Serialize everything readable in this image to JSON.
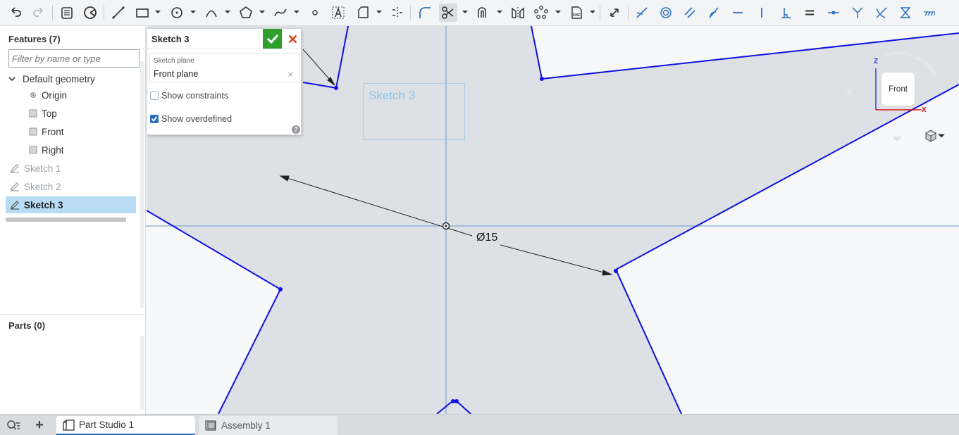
{
  "toolbar": {
    "tools": [
      {
        "name": "undo-icon"
      },
      {
        "name": "redo-icon"
      },
      {
        "name": "finish-sketch-icon"
      },
      {
        "name": "sketch-palette-icon"
      },
      {
        "name": "line-tool-icon"
      },
      {
        "name": "rectangle-tool-icon"
      },
      {
        "name": "circle-tool-icon"
      },
      {
        "name": "arc-tool-icon"
      },
      {
        "name": "polygon-tool-icon"
      },
      {
        "name": "spline-tool-icon"
      },
      {
        "name": "point-tool-icon"
      },
      {
        "name": "text-tool-icon"
      },
      {
        "name": "construction-icon"
      },
      {
        "name": "midpoint-line-icon"
      },
      {
        "name": "fillet-icon"
      },
      {
        "name": "trim-icon"
      },
      {
        "name": "offset-icon"
      },
      {
        "name": "mirror-icon"
      },
      {
        "name": "pattern-icon"
      },
      {
        "name": "dxf-import-icon"
      },
      {
        "name": "dimension-icon"
      },
      {
        "name": "coincident-icon"
      },
      {
        "name": "concentric-icon"
      },
      {
        "name": "parallel-icon"
      },
      {
        "name": "tangent-icon"
      },
      {
        "name": "horizontal-icon"
      },
      {
        "name": "vertical-icon"
      },
      {
        "name": "perpendicular-icon"
      },
      {
        "name": "equal-icon"
      },
      {
        "name": "midpoint-icon"
      },
      {
        "name": "normal-icon"
      },
      {
        "name": "pierce-icon"
      },
      {
        "name": "symmetric-icon"
      },
      {
        "name": "fix-icon"
      }
    ],
    "dxf_label": "DXF"
  },
  "features_panel": {
    "title": "Features (7)",
    "filter_placeholder": "Filter by name or type",
    "items": [
      {
        "label": "Default geometry"
      },
      {
        "label": "Origin"
      },
      {
        "label": "Top"
      },
      {
        "label": "Front"
      },
      {
        "label": "Right"
      },
      {
        "label": "Sketch 1"
      },
      {
        "label": "Sketch 2"
      },
      {
        "label": "Sketch 3"
      }
    ],
    "parts_title": "Parts (0)"
  },
  "sketch_dialog": {
    "title": "Sketch 3",
    "plane_label": "Sketch plane",
    "plane_value": "Front plane",
    "show_constraints_label": "Show constraints",
    "show_constraints_checked": false,
    "show_overdefined_label": "Show overdefined",
    "show_overdefined_checked": true,
    "help_glyph": "?"
  },
  "canvas": {
    "sketch_name": "Sketch 3",
    "dimension_label": "Ø15"
  },
  "view_cube": {
    "face_label": "Front",
    "axis_z": "Z",
    "axis_x": "X"
  },
  "tabs": [
    {
      "label": "Part Studio 1",
      "active": true
    },
    {
      "label": "Assembly 1",
      "active": false
    }
  ],
  "colors": {
    "sketch_line": "#1010e0",
    "accent": "#2a6ebf",
    "ok_button": "#2f9e2a",
    "cancel_x": "#d9481c",
    "selected_row": "#b9dcf5",
    "region_fill": "#dde1e6"
  }
}
